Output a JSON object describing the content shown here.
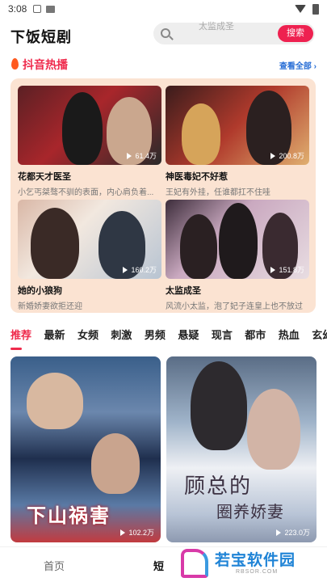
{
  "status_bar": {
    "time": "3:08"
  },
  "header": {
    "app_title": "下饭短剧",
    "search_placeholder": "太监成圣",
    "search_button": "搜索"
  },
  "hot": {
    "title": "抖音热播",
    "see_all": "查看全部 ›"
  },
  "hot_cards": [
    {
      "title": "花都天才医圣",
      "desc": "小乞丐桀骜不驯的表面，内心肩负着...",
      "views": "61.4万"
    },
    {
      "title": "神医毒妃不好惹",
      "desc": "王妃有外挂，任谁都扛不住哇",
      "views": "200.8万"
    },
    {
      "title": "她的小狼狗",
      "desc": "新婚娇妻欲拒还迎",
      "views": "160.2万"
    },
    {
      "title": "太监成圣",
      "desc": "风流小太监，泡了妃子连皇上也不放过",
      "views": "151.8万"
    }
  ],
  "tabs": [
    "推荐",
    "最新",
    "女频",
    "刺激",
    "男频",
    "悬疑",
    "现言",
    "都市",
    "热血",
    "玄幻"
  ],
  "feed": [
    {
      "poster_text": "下山祸害",
      "views": "102.2万"
    },
    {
      "poster_text": "顾总的",
      "poster_sub": "圈养娇妻",
      "views": "223.0万"
    }
  ],
  "bottom_nav": {
    "home": "首页",
    "short": "短"
  },
  "watermark": {
    "text": "若宝软件园",
    "url": "RBSOR.COM"
  },
  "colors": {
    "accent": "#ef2a4c",
    "link": "#2a6fd6",
    "panel": "#fbe3d2"
  }
}
